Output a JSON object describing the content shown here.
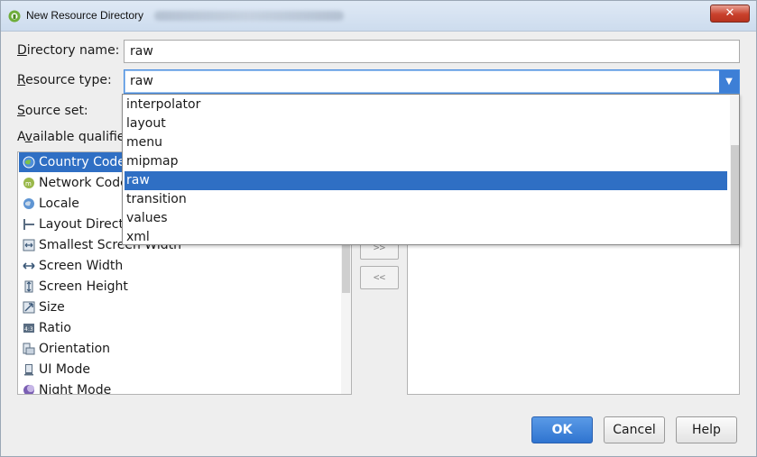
{
  "window": {
    "title": "New Resource Directory",
    "close_glyph": "✕"
  },
  "form": {
    "directory_name_label_mn": "D",
    "directory_name_label_rest": "irectory name:",
    "directory_name_value": "raw",
    "resource_type_label_mn": "R",
    "resource_type_label_rest": "esource type:",
    "resource_type_value": "raw",
    "source_set_label_mn": "S",
    "source_set_label_rest": "ource set:",
    "available_qualifiers_label_pre": "A",
    "available_qualifiers_label_mn": "v",
    "available_qualifiers_label_rest": "ailable qualifie"
  },
  "qualifiers": [
    {
      "label": "Country Code",
      "icon": "globe-icon",
      "selected": true
    },
    {
      "label": "Network Code",
      "icon": "network-icon",
      "selected": false
    },
    {
      "label": "Locale",
      "icon": "locale-globe-icon",
      "selected": false
    },
    {
      "label": "Layout Directi",
      "icon": "layout-direction-icon",
      "selected": false
    },
    {
      "label": "Smallest Screen Width",
      "icon": "smallest-width-icon",
      "selected": false
    },
    {
      "label": "Screen Width",
      "icon": "screen-width-icon",
      "selected": false
    },
    {
      "label": "Screen Height",
      "icon": "screen-height-icon",
      "selected": false
    },
    {
      "label": "Size",
      "icon": "size-icon",
      "selected": false
    },
    {
      "label": "Ratio",
      "icon": "ratio-icon",
      "selected": false
    },
    {
      "label": "Orientation",
      "icon": "orientation-icon",
      "selected": false
    },
    {
      "label": "UI Mode",
      "icon": "ui-mode-icon",
      "selected": false
    },
    {
      "label": "Night Mode",
      "icon": "night-mode-icon",
      "selected": false
    }
  ],
  "transfer": {
    "add_label": ">>",
    "remove_label": "<<"
  },
  "dropdown_options": [
    {
      "label": "interpolator",
      "selected": false
    },
    {
      "label": "layout",
      "selected": false
    },
    {
      "label": "menu",
      "selected": false
    },
    {
      "label": "mipmap",
      "selected": false
    },
    {
      "label": "raw",
      "selected": true
    },
    {
      "label": "transition",
      "selected": false
    },
    {
      "label": "values",
      "selected": false
    },
    {
      "label": "xml",
      "selected": false
    }
  ],
  "buttons": {
    "ok": "OK",
    "cancel": "Cancel",
    "help": "Help"
  },
  "colors": {
    "selection": "#2f6fc4",
    "accent": "#3d7fd6",
    "close": "#c9412c"
  }
}
